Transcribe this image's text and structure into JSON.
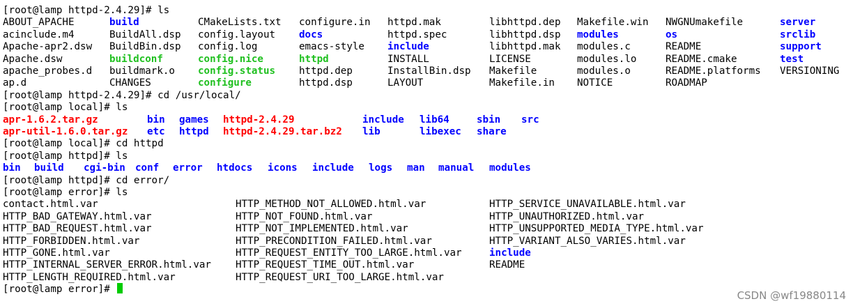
{
  "terminal": {
    "lines": [
      {
        "type": "prompt",
        "text": "[root@lamp httpd-2.4.29]# ls"
      },
      {
        "type": "grid",
        "columns": [
          {
            "col": 0,
            "items": [
              {
                "t": "ABOUT_APACHE",
                "c": "plain"
              },
              {
                "t": "acinclude.m4",
                "c": "plain"
              },
              {
                "t": "Apache-apr2.dsw",
                "c": "plain"
              },
              {
                "t": "Apache.dsw",
                "c": "plain"
              },
              {
                "t": "apache_probes.d",
                "c": "plain"
              },
              {
                "t": "ap.d",
                "c": "plain"
              }
            ]
          },
          {
            "col": 1,
            "items": [
              {
                "t": "build",
                "c": "blue"
              },
              {
                "t": "BuildAll.dsp",
                "c": "plain"
              },
              {
                "t": "BuildBin.dsp",
                "c": "plain"
              },
              {
                "t": "buildconf",
                "c": "green"
              },
              {
                "t": "buildmark.o",
                "c": "plain"
              },
              {
                "t": "CHANGES",
                "c": "plain"
              }
            ]
          },
          {
            "col": 2,
            "items": [
              {
                "t": "CMakeLists.txt",
                "c": "plain"
              },
              {
                "t": "config.layout",
                "c": "plain"
              },
              {
                "t": "config.log",
                "c": "plain"
              },
              {
                "t": "config.nice",
                "c": "green"
              },
              {
                "t": "config.status",
                "c": "green"
              },
              {
                "t": "configure",
                "c": "green"
              }
            ]
          },
          {
            "col": 3,
            "items": [
              {
                "t": "configure.in",
                "c": "plain"
              },
              {
                "t": "docs",
                "c": "blue"
              },
              {
                "t": "emacs-style",
                "c": "plain"
              },
              {
                "t": "httpd",
                "c": "green"
              },
              {
                "t": "httpd.dep",
                "c": "plain"
              },
              {
                "t": "httpd.dsp",
                "c": "plain"
              }
            ]
          },
          {
            "col": 4,
            "items": [
              {
                "t": "httpd.mak",
                "c": "plain"
              },
              {
                "t": "httpd.spec",
                "c": "plain"
              },
              {
                "t": "include",
                "c": "blue"
              },
              {
                "t": "INSTALL",
                "c": "plain"
              },
              {
                "t": "InstallBin.dsp",
                "c": "plain"
              },
              {
                "t": "LAYOUT",
                "c": "plain"
              }
            ]
          },
          {
            "col": 5,
            "items": [
              {
                "t": "libhttpd.dep",
                "c": "plain"
              },
              {
                "t": "libhttpd.dsp",
                "c": "plain"
              },
              {
                "t": "libhttpd.mak",
                "c": "plain"
              },
              {
                "t": "LICENSE",
                "c": "plain"
              },
              {
                "t": "Makefile",
                "c": "plain"
              },
              {
                "t": "Makefile.in",
                "c": "plain"
              }
            ]
          },
          {
            "col": 6,
            "items": [
              {
                "t": "Makefile.win",
                "c": "plain"
              },
              {
                "t": "modules",
                "c": "blue"
              },
              {
                "t": "modules.c",
                "c": "plain"
              },
              {
                "t": "modules.lo",
                "c": "plain"
              },
              {
                "t": "modules.o",
                "c": "plain"
              },
              {
                "t": "NOTICE",
                "c": "plain"
              }
            ]
          },
          {
            "col": 7,
            "items": [
              {
                "t": "NWGNUmakefile",
                "c": "plain"
              },
              {
                "t": "os",
                "c": "blue"
              },
              {
                "t": "README",
                "c": "plain"
              },
              {
                "t": "README.cmake",
                "c": "plain"
              },
              {
                "t": "README.platforms",
                "c": "plain"
              },
              {
                "t": "ROADMAP",
                "c": "plain"
              }
            ]
          },
          {
            "col": 8,
            "items": [
              {
                "t": "server",
                "c": "blue"
              },
              {
                "t": "srclib",
                "c": "blue"
              },
              {
                "t": "support",
                "c": "blue"
              },
              {
                "t": "test",
                "c": "blue"
              },
              {
                "t": "VERSIONING",
                "c": "plain"
              },
              {
                "t": "",
                "c": "plain"
              }
            ]
          }
        ]
      },
      {
        "type": "prompt",
        "text": "[root@lamp httpd-2.4.29]# cd /usr/local/"
      },
      {
        "type": "prompt",
        "text": "[root@lamp local]# ls"
      },
      {
        "type": "row",
        "items": [
          {
            "t": "apr-1.6.2.tar.gz",
            "c": "red"
          },
          {
            "t": "bin",
            "c": "blue"
          },
          {
            "t": "games",
            "c": "blue"
          },
          {
            "t": "httpd-2.4.29",
            "c": "red"
          },
          {
            "t": "include",
            "c": "blue"
          },
          {
            "t": "lib64",
            "c": "blue"
          },
          {
            "t": "sbin",
            "c": "blue"
          },
          {
            "t": "src",
            "c": "blue"
          }
        ]
      },
      {
        "type": "row",
        "items": [
          {
            "t": "apr-util-1.6.0.tar.gz",
            "c": "red"
          },
          {
            "t": "etc",
            "c": "blue"
          },
          {
            "t": "httpd",
            "c": "blue"
          },
          {
            "t": "httpd-2.4.29.tar.bz2",
            "c": "red"
          },
          {
            "t": "lib",
            "c": "blue"
          },
          {
            "t": "libexec",
            "c": "blue"
          },
          {
            "t": "share",
            "c": "blue"
          }
        ]
      },
      {
        "type": "prompt",
        "text": "[root@lamp local]# cd httpd"
      },
      {
        "type": "prompt",
        "text": "[root@lamp httpd]# ls"
      },
      {
        "type": "row",
        "items": [
          {
            "t": "bin",
            "c": "blue"
          },
          {
            "t": "build",
            "c": "blue"
          },
          {
            "t": "cgi-bin",
            "c": "blue"
          },
          {
            "t": "conf",
            "c": "blue"
          },
          {
            "t": "error",
            "c": "blue"
          },
          {
            "t": "htdocs",
            "c": "blue"
          },
          {
            "t": "icons",
            "c": "blue"
          },
          {
            "t": "include",
            "c": "blue"
          },
          {
            "t": "logs",
            "c": "blue"
          },
          {
            "t": "man",
            "c": "blue"
          },
          {
            "t": "manual",
            "c": "blue"
          },
          {
            "t": "modules",
            "c": "blue"
          }
        ]
      },
      {
        "type": "prompt",
        "text": "[root@lamp httpd]# cd error/"
      },
      {
        "type": "prompt",
        "text": "[root@lamp error]# ls"
      },
      {
        "type": "grid",
        "columns": [
          {
            "col": 0,
            "items": [
              {
                "t": "contact.html.var",
                "c": "plain"
              },
              {
                "t": "HTTP_BAD_GATEWAY.html.var",
                "c": "plain"
              },
              {
                "t": "HTTP_BAD_REQUEST.html.var",
                "c": "plain"
              },
              {
                "t": "HTTP_FORBIDDEN.html.var",
                "c": "plain"
              },
              {
                "t": "HTTP_GONE.html.var",
                "c": "plain"
              },
              {
                "t": "HTTP_INTERNAL_SERVER_ERROR.html.var",
                "c": "plain"
              },
              {
                "t": "HTTP_LENGTH_REQUIRED.html.var",
                "c": "plain"
              }
            ]
          },
          {
            "col": 1,
            "items": [
              {
                "t": "HTTP_METHOD_NOT_ALLOWED.html.var",
                "c": "plain"
              },
              {
                "t": "HTTP_NOT_FOUND.html.var",
                "c": "plain"
              },
              {
                "t": "HTTP_NOT_IMPLEMENTED.html.var",
                "c": "plain"
              },
              {
                "t": "HTTP_PRECONDITION_FAILED.html.var",
                "c": "plain"
              },
              {
                "t": "HTTP_REQUEST_ENTITY_TOO_LARGE.html.var",
                "c": "plain"
              },
              {
                "t": "HTTP_REQUEST_TIME_OUT.html.var",
                "c": "plain"
              },
              {
                "t": "HTTP_REQUEST_URI_TOO_LARGE.html.var",
                "c": "plain"
              }
            ]
          },
          {
            "col": 2,
            "items": [
              {
                "t": "HTTP_SERVICE_UNAVAILABLE.html.var",
                "c": "plain"
              },
              {
                "t": "HTTP_UNAUTHORIZED.html.var",
                "c": "plain"
              },
              {
                "t": "HTTP_UNSUPPORTED_MEDIA_TYPE.html.var",
                "c": "plain"
              },
              {
                "t": "HTTP_VARIANT_ALSO_VARIES.html.var",
                "c": "plain"
              },
              {
                "t": "include",
                "c": "blue"
              },
              {
                "t": "README",
                "c": "plain"
              },
              {
                "t": "",
                "c": "plain"
              }
            ]
          }
        ]
      },
      {
        "type": "prompt",
        "text": "[root@lamp error]# ",
        "cursor": true
      }
    ]
  },
  "watermark": "CSDN @wf19880114",
  "colors": {
    "background": "#ffffff",
    "text": "#000000",
    "directory": "#0000ff",
    "executable": "#20c020",
    "archive": "#ff0000",
    "cursor": "#00cc00"
  }
}
